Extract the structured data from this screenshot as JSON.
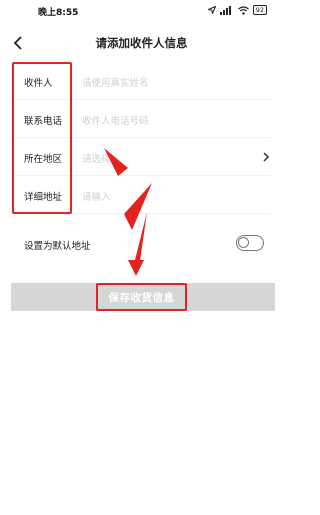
{
  "status_bar": {
    "time": "晚上8:55",
    "battery": "92"
  },
  "header": {
    "title": "请添加收件人信息"
  },
  "form": {
    "rows": [
      {
        "label": "收件人",
        "placeholder": "请使用真实姓名"
      },
      {
        "label": "联系电话",
        "placeholder": "收件人电话号码"
      },
      {
        "label": "所在地区",
        "placeholder": "请选择"
      },
      {
        "label": "详细地址",
        "placeholder": "请输入"
      }
    ]
  },
  "default_address": {
    "label": "设置为默认地址",
    "enabled": false
  },
  "save_button": {
    "label": "保存收货信息"
  },
  "colors": {
    "annotation_red": "#e3231f",
    "button_gray": "#d6d6d6",
    "placeholder_gray": "#cfcfcf"
  },
  "icons": [
    "navigation-icon",
    "signal-icon",
    "wifi-icon",
    "battery-icon",
    "back-arrow-icon",
    "chevron-right-icon"
  ]
}
